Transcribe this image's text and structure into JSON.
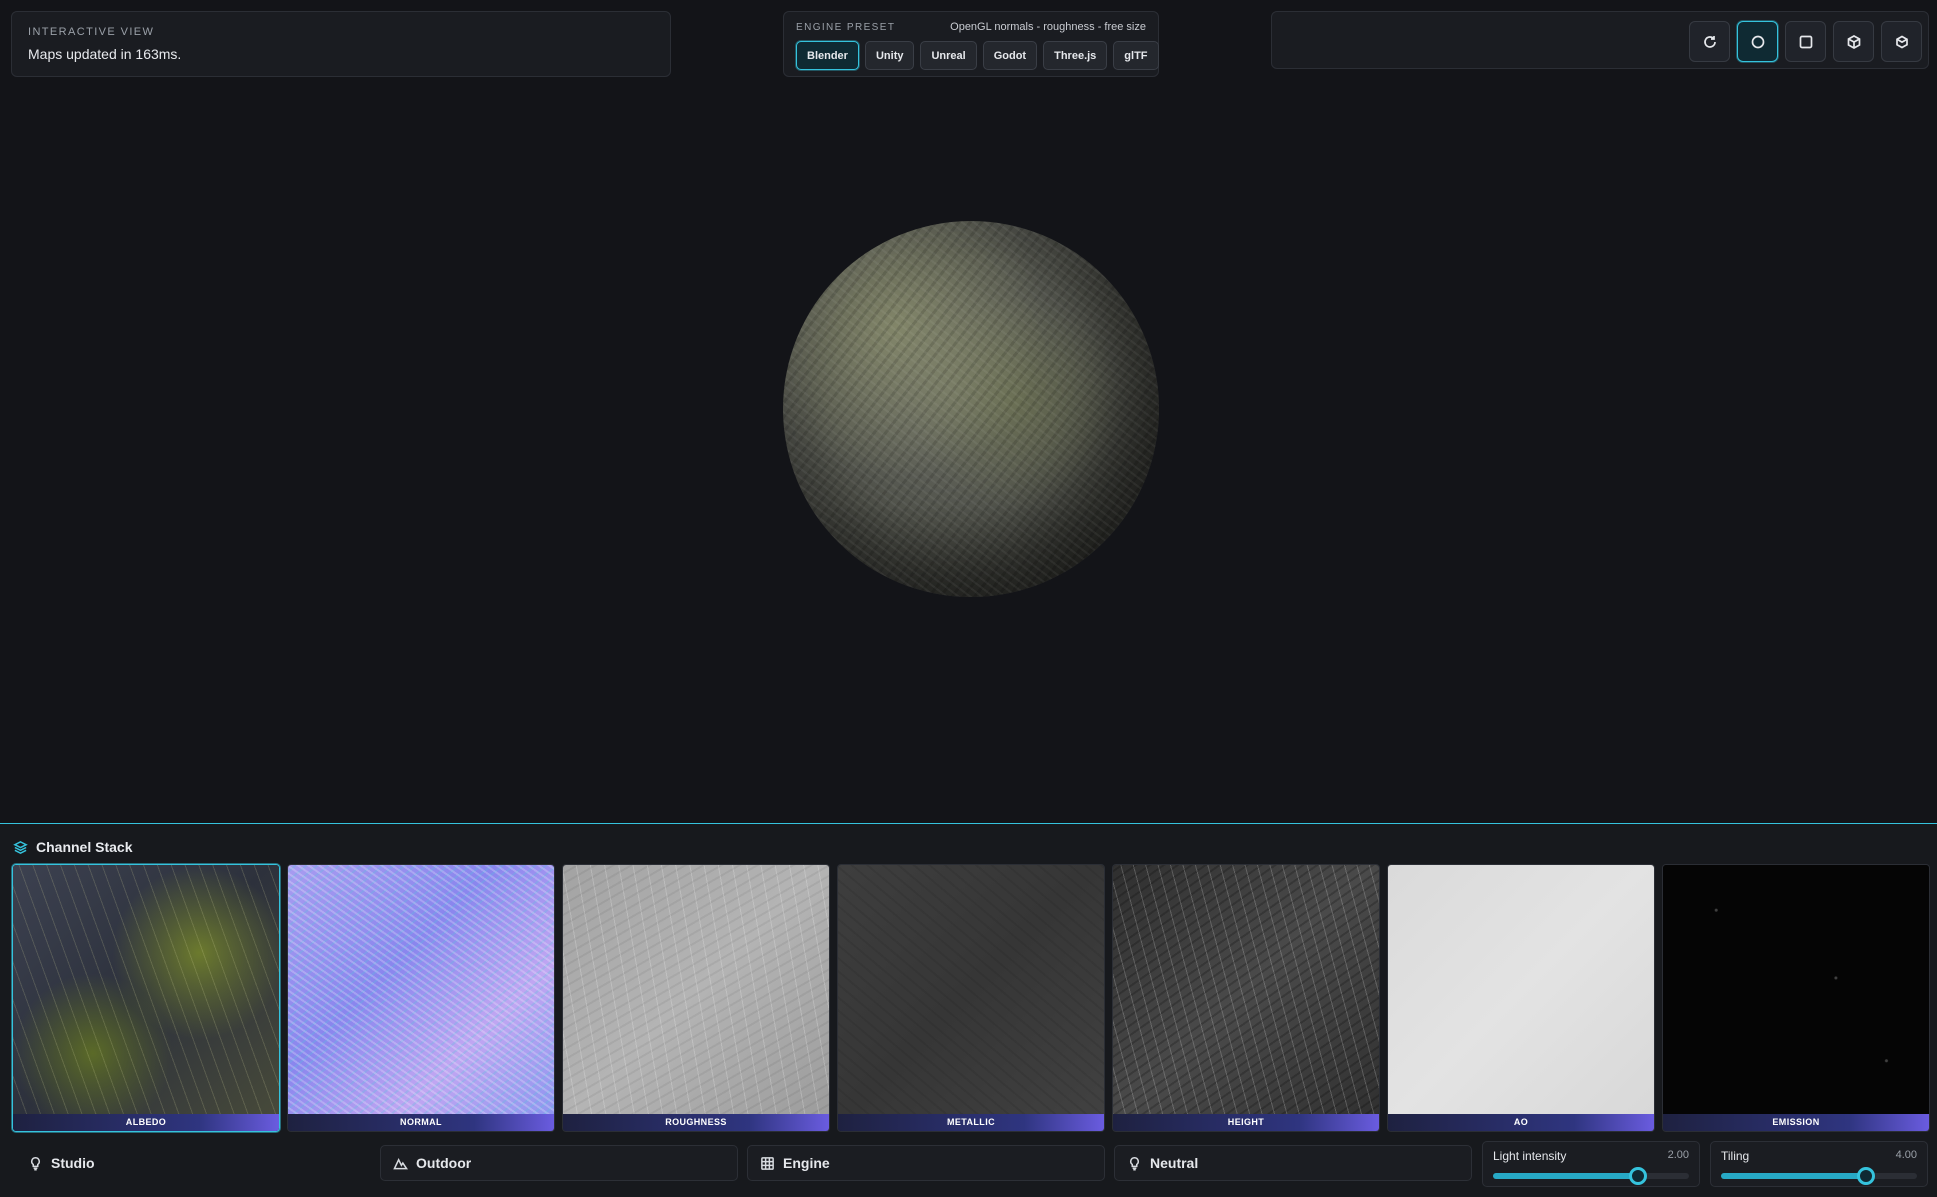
{
  "info": {
    "title": "INTERACTIVE VIEW",
    "status": "Maps updated in 163ms."
  },
  "preset": {
    "title": "ENGINE PRESET",
    "description": "OpenGL normals - roughness - free size",
    "options": [
      "Blender",
      "Unity",
      "Unreal",
      "Godot",
      "Three.js",
      "glTF"
    ],
    "selected": "Blender"
  },
  "toolbar": {
    "buttons": [
      "refresh-icon",
      "sphere-icon",
      "plane-icon",
      "cube-icon",
      "cube-alt-icon"
    ],
    "active": "sphere-icon"
  },
  "channels": {
    "title": "Channel Stack",
    "items": [
      {
        "label": "ALBEDO",
        "active": true
      },
      {
        "label": "NORMAL",
        "active": false
      },
      {
        "label": "ROUGHNESS",
        "active": false
      },
      {
        "label": "METALLIC",
        "active": false
      },
      {
        "label": "HEIGHT",
        "active": false
      },
      {
        "label": "AO",
        "active": false
      },
      {
        "label": "EMISSION",
        "active": false
      }
    ]
  },
  "environments": [
    "Studio",
    "Outdoor",
    "Engine",
    "Neutral"
  ],
  "light_intensity": {
    "label": "Light intensity",
    "value": "2.00",
    "fraction": 0.74
  },
  "tiling": {
    "label": "Tiling",
    "value": "4.00",
    "fraction": 0.74
  },
  "colors": {
    "accent": "#35c3dd",
    "background": "#131418",
    "panel": "#1a1c21"
  }
}
